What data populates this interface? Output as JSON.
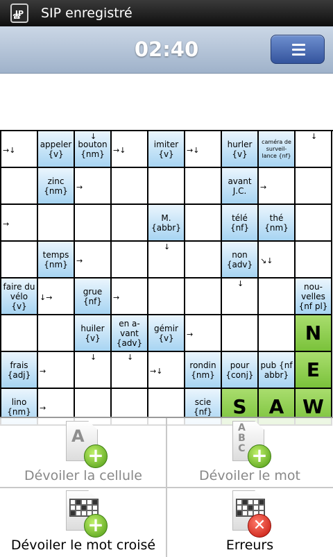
{
  "status_bar": {
    "app_icon": "IP",
    "title": "SIP enregistré"
  },
  "header": {
    "timer": "02:40",
    "menu_icon": "hamburger-icon"
  },
  "crossword": {
    "cells": [
      {
        "t": "blank",
        "a": "→↓"
      },
      {
        "t": "clue",
        "text": "appeler {v}"
      },
      {
        "t": "clue",
        "text": "bouton {nm}",
        "a": "↓"
      },
      {
        "t": "blank",
        "a": "→↓"
      },
      {
        "t": "clue",
        "text": "imiter {v}"
      },
      {
        "t": "blank",
        "a": "→↓"
      },
      {
        "t": "clue",
        "text": "hurler {v}"
      },
      {
        "t": "clue",
        "text": "caméra de surveil- lance {nf}",
        "small": true
      },
      {
        "t": "blank",
        "a": "↓"
      },
      {
        "t": "blank"
      },
      {
        "t": "clue",
        "text": "zinc {nm}"
      },
      {
        "t": "blank",
        "a": "→"
      },
      {
        "t": "blank"
      },
      {
        "t": "blank"
      },
      {
        "t": "blank"
      },
      {
        "t": "clue",
        "text": "avant J.C."
      },
      {
        "t": "blank",
        "a": "→"
      },
      {
        "t": "blank"
      },
      {
        "t": "blank",
        "a": "→"
      },
      {
        "t": "blank"
      },
      {
        "t": "blank"
      },
      {
        "t": "blank"
      },
      {
        "t": "clue",
        "text": "M. {abbr}"
      },
      {
        "t": "blank"
      },
      {
        "t": "clue",
        "text": "télé {nf}"
      },
      {
        "t": "clue",
        "text": "thé {nm}"
      },
      {
        "t": "blank"
      },
      {
        "t": "blank"
      },
      {
        "t": "clue",
        "text": "temps {nm}"
      },
      {
        "t": "blank",
        "a": "→"
      },
      {
        "t": "blank"
      },
      {
        "t": "blank",
        "a": "↓"
      },
      {
        "t": "blank"
      },
      {
        "t": "clue",
        "text": "non {adv}"
      },
      {
        "t": "blank",
        "a": "↘↓"
      },
      {
        "t": "blank"
      },
      {
        "t": "clue",
        "text": "faire du vélo {v}"
      },
      {
        "t": "blank",
        "a": "↓→"
      },
      {
        "t": "clue",
        "text": "grue {nf}"
      },
      {
        "t": "blank",
        "a": "→"
      },
      {
        "t": "blank"
      },
      {
        "t": "blank"
      },
      {
        "t": "blank",
        "a": "↓"
      },
      {
        "t": "blank"
      },
      {
        "t": "clue",
        "text": "nou- velles {nf pl}"
      },
      {
        "t": "blank"
      },
      {
        "t": "blank"
      },
      {
        "t": "clue",
        "text": "huiler {v}"
      },
      {
        "t": "clue",
        "text": "en a- vant {adv}"
      },
      {
        "t": "clue",
        "text": "gémir {v}"
      },
      {
        "t": "blank",
        "a": "→"
      },
      {
        "t": "blank"
      },
      {
        "t": "blank"
      },
      {
        "t": "letter",
        "text": "N"
      },
      {
        "t": "clue",
        "text": "frais {adj}"
      },
      {
        "t": "blank",
        "a": "→"
      },
      {
        "t": "blank",
        "a": "↓"
      },
      {
        "t": "blank",
        "a": "↓"
      },
      {
        "t": "blank",
        "a": "→↓"
      },
      {
        "t": "clue",
        "text": "rondin {nm}"
      },
      {
        "t": "clue",
        "text": "pour {conj}"
      },
      {
        "t": "clue",
        "text": "pub {nf abbr}"
      },
      {
        "t": "letter",
        "text": "E"
      },
      {
        "t": "clue",
        "text": "lino {nm}"
      },
      {
        "t": "blank",
        "a": "→"
      },
      {
        "t": "blank"
      },
      {
        "t": "blank"
      },
      {
        "t": "blank"
      },
      {
        "t": "clue",
        "text": "scie {nf}"
      },
      {
        "t": "letter",
        "text": "S"
      },
      {
        "t": "letter",
        "text": "A"
      },
      {
        "t": "letter",
        "text": "W"
      }
    ]
  },
  "actions": {
    "reveal_cell": "Dévoiler la cellule",
    "reveal_word": "Dévoiler le mot",
    "reveal_crossword": "Dévoiler le mot croisé",
    "errors": "Erreurs"
  }
}
